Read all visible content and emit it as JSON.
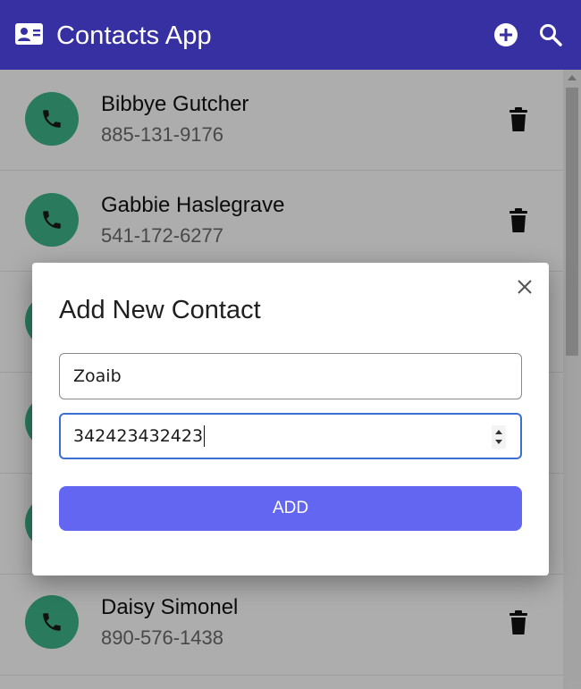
{
  "app": {
    "title": "Contacts App",
    "brand_icon": "contact-card-icon",
    "add_icon": "plus-circle-icon",
    "search_icon": "search-icon"
  },
  "contacts": [
    {
      "name": "Bibbye Gutcher",
      "phone": "885-131-9176"
    },
    {
      "name": "Gabbie Haslegrave",
      "phone": "541-172-6277"
    },
    {
      "name": "",
      "phone": ""
    },
    {
      "name": "",
      "phone": ""
    },
    {
      "name": "",
      "phone": ""
    },
    {
      "name": "Daisy Simonel",
      "phone": "890-576-1438"
    }
  ],
  "modal": {
    "title": "Add New Contact",
    "name_value": "Zoaib",
    "phone_value": "342423432423",
    "add_label": "ADD",
    "close_icon": "close-icon"
  },
  "colors": {
    "header": "#3730a3",
    "avatar": "#3fb68b",
    "add_button": "#6366f1",
    "focus_border": "#3b6fd4"
  }
}
